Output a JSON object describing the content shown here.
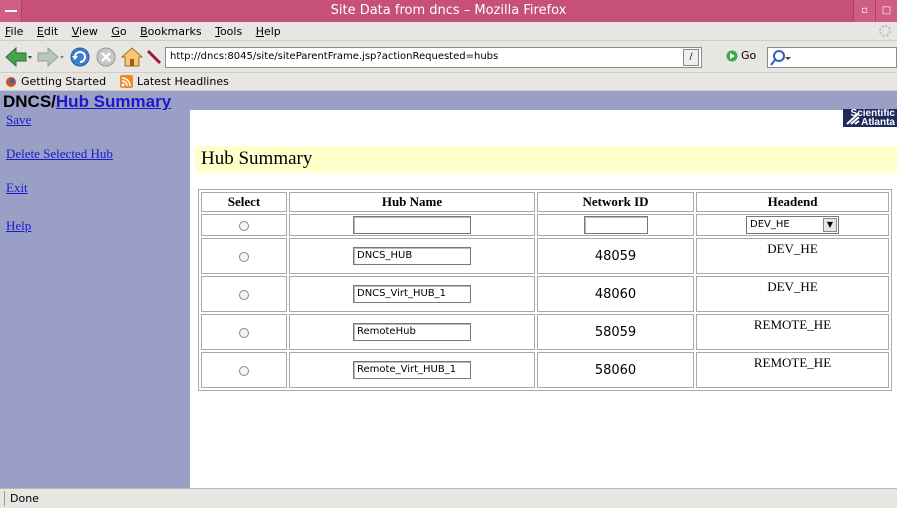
{
  "window": {
    "title": "Site Data from dncs – Mozilla Firefox"
  },
  "menu": {
    "items": [
      {
        "accel": "F",
        "rest": "ile"
      },
      {
        "accel": "E",
        "rest": "dit"
      },
      {
        "accel": "V",
        "rest": "iew"
      },
      {
        "accel": "G",
        "rest": "o"
      },
      {
        "accel": "B",
        "rest": "ookmarks"
      },
      {
        "accel": "T",
        "rest": "ools"
      },
      {
        "accel": "H",
        "rest": "elp"
      }
    ]
  },
  "navigation": {
    "url": "http://dncs:8045/site/siteParentFrame.jsp?actionRequested=hubs",
    "go_label": "Go"
  },
  "bookmarks": {
    "items": [
      "Getting Started",
      "Latest Headlines"
    ]
  },
  "page": {
    "header_prefix": "DNCS/",
    "header_link": "Hub Summary",
    "logo_line1": "Scientific",
    "logo_line2": "Atlanta",
    "title": "Hub Summary"
  },
  "sidebar": {
    "links": [
      "Save",
      "Delete Selected Hub",
      "Exit",
      "Help"
    ]
  },
  "table": {
    "headers": [
      "Select",
      "Hub Name",
      "Network ID",
      "Headend"
    ],
    "new_row": {
      "hub_name": "",
      "network_id": "",
      "headend_select": "DEV_HE"
    },
    "rows": [
      {
        "hub_name": "DNCS_HUB",
        "network_id": "48059",
        "headend": "DEV_HE"
      },
      {
        "hub_name": "DNCS_Virt_HUB_1",
        "network_id": "48060",
        "headend": "DEV_HE"
      },
      {
        "hub_name": "RemoteHub",
        "network_id": "58059",
        "headend": "REMOTE_HE"
      },
      {
        "hub_name": "Remote_Virt_HUB_1",
        "network_id": "58060",
        "headend": "REMOTE_HE"
      }
    ]
  },
  "status": {
    "text": "Done"
  },
  "colors": {
    "titlebar": "#c7507a",
    "frame_background": "#9a9fc5",
    "title_band": "#ffffcc",
    "link": "#1a1acc"
  }
}
